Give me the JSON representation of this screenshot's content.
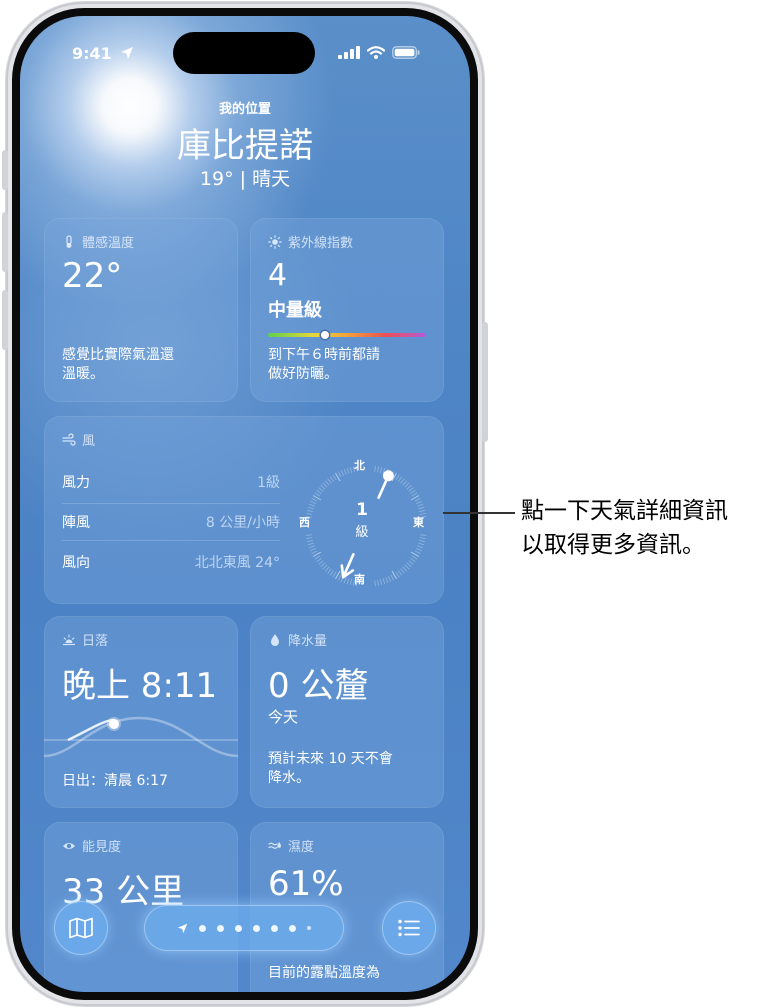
{
  "status_bar": {
    "time": "9:41"
  },
  "header": {
    "subtitle": "我的位置",
    "city": "庫比提諾",
    "summary": "19° | 晴天"
  },
  "feels_like": {
    "title": "體感溫度",
    "value": "22°",
    "description_line1": "感覺比實際氣溫還",
    "description_line2": "溫暖。"
  },
  "uv": {
    "title": "紫外線指數",
    "value": "4",
    "level": "中量級",
    "scale_position_fraction": 0.36,
    "description_line1": "到下午６時前都請",
    "description_line2": "做好防曬。"
  },
  "wind": {
    "title": "風",
    "rows": [
      {
        "label": "風力",
        "value": "1級"
      },
      {
        "label": "陣風",
        "value": "8 公里/小時"
      },
      {
        "label": "風向",
        "value": "北北東風 24°"
      }
    ],
    "compass": {
      "north": "北",
      "south": "南",
      "east": "東",
      "west": "西",
      "center_number": "1",
      "center_unit": "級"
    },
    "direction_degrees": 24
  },
  "sunset": {
    "title": "日落",
    "value": "晚上 8:11",
    "sunrise": "日出：清晨 6:17"
  },
  "precipitation": {
    "title": "降水量",
    "value": "0 公釐",
    "period": "今天",
    "description_line1": "預計未來 10 天不會",
    "description_line2": "降水。"
  },
  "visibility": {
    "title": "能見度",
    "value": "33 公里"
  },
  "humidity": {
    "title": "濕度",
    "value": "61%",
    "description": "目前的露點溫度為"
  },
  "callout": {
    "line1": "點一下天氣詳細資訊",
    "line2": "以取得更多資訊。"
  },
  "colors": {
    "sky_blue": "#4f86c6",
    "card": "rgba(120,165,220,0.42)",
    "uv_indicator": "#ffffff"
  }
}
